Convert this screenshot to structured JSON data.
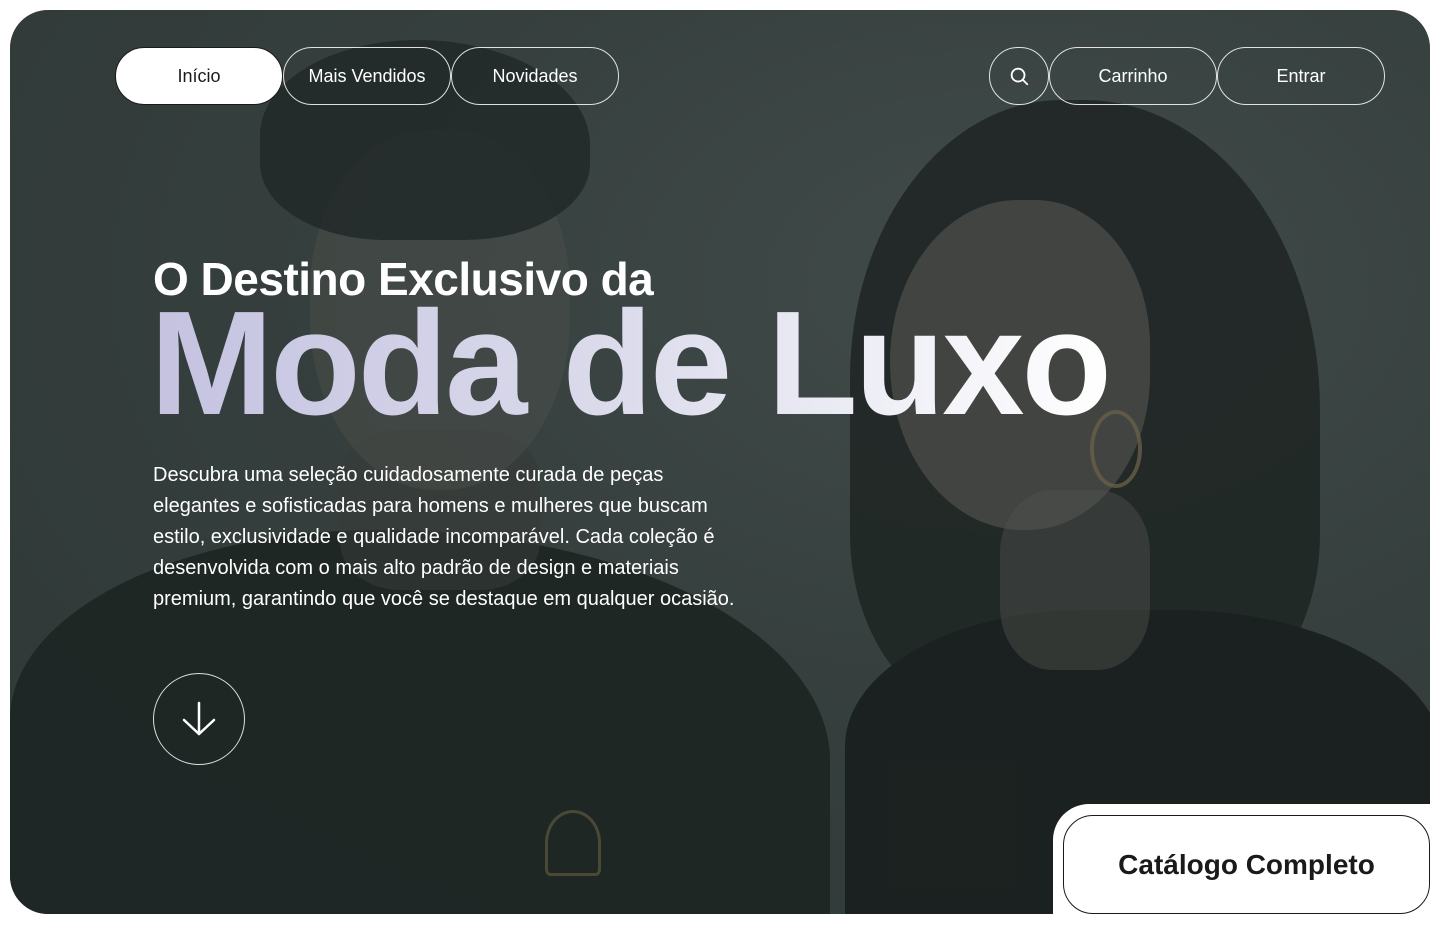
{
  "nav": {
    "left": [
      {
        "label": "Início",
        "active": true
      },
      {
        "label": "Mais Vendidos",
        "active": false
      },
      {
        "label": "Novidades",
        "active": false
      }
    ],
    "right": {
      "search_icon": "search-icon",
      "cart_label": "Carrinho",
      "login_label": "Entrar"
    }
  },
  "hero": {
    "kicker": "O Destino Exclusivo da",
    "headline": "Moda de Luxo",
    "description": "Descubra uma seleção cuidadosamente curada de peças elegantes e sofisticadas para homens e mulheres que buscam estilo, exclusividade e qualidade incomparável. Cada coleção é desenvolvida com o mais alto padrão de design e materiais premium, garantindo que você se destaque em qualquer ocasião.",
    "scroll_icon": "arrow-down-icon",
    "headline_gradient": [
      "#c4c2e0",
      "#ffffff"
    ]
  },
  "catalog_button": {
    "label": "Catálogo Completo"
  },
  "colors": {
    "background": "#3e4845",
    "accent_text": "#1a1a1a"
  }
}
